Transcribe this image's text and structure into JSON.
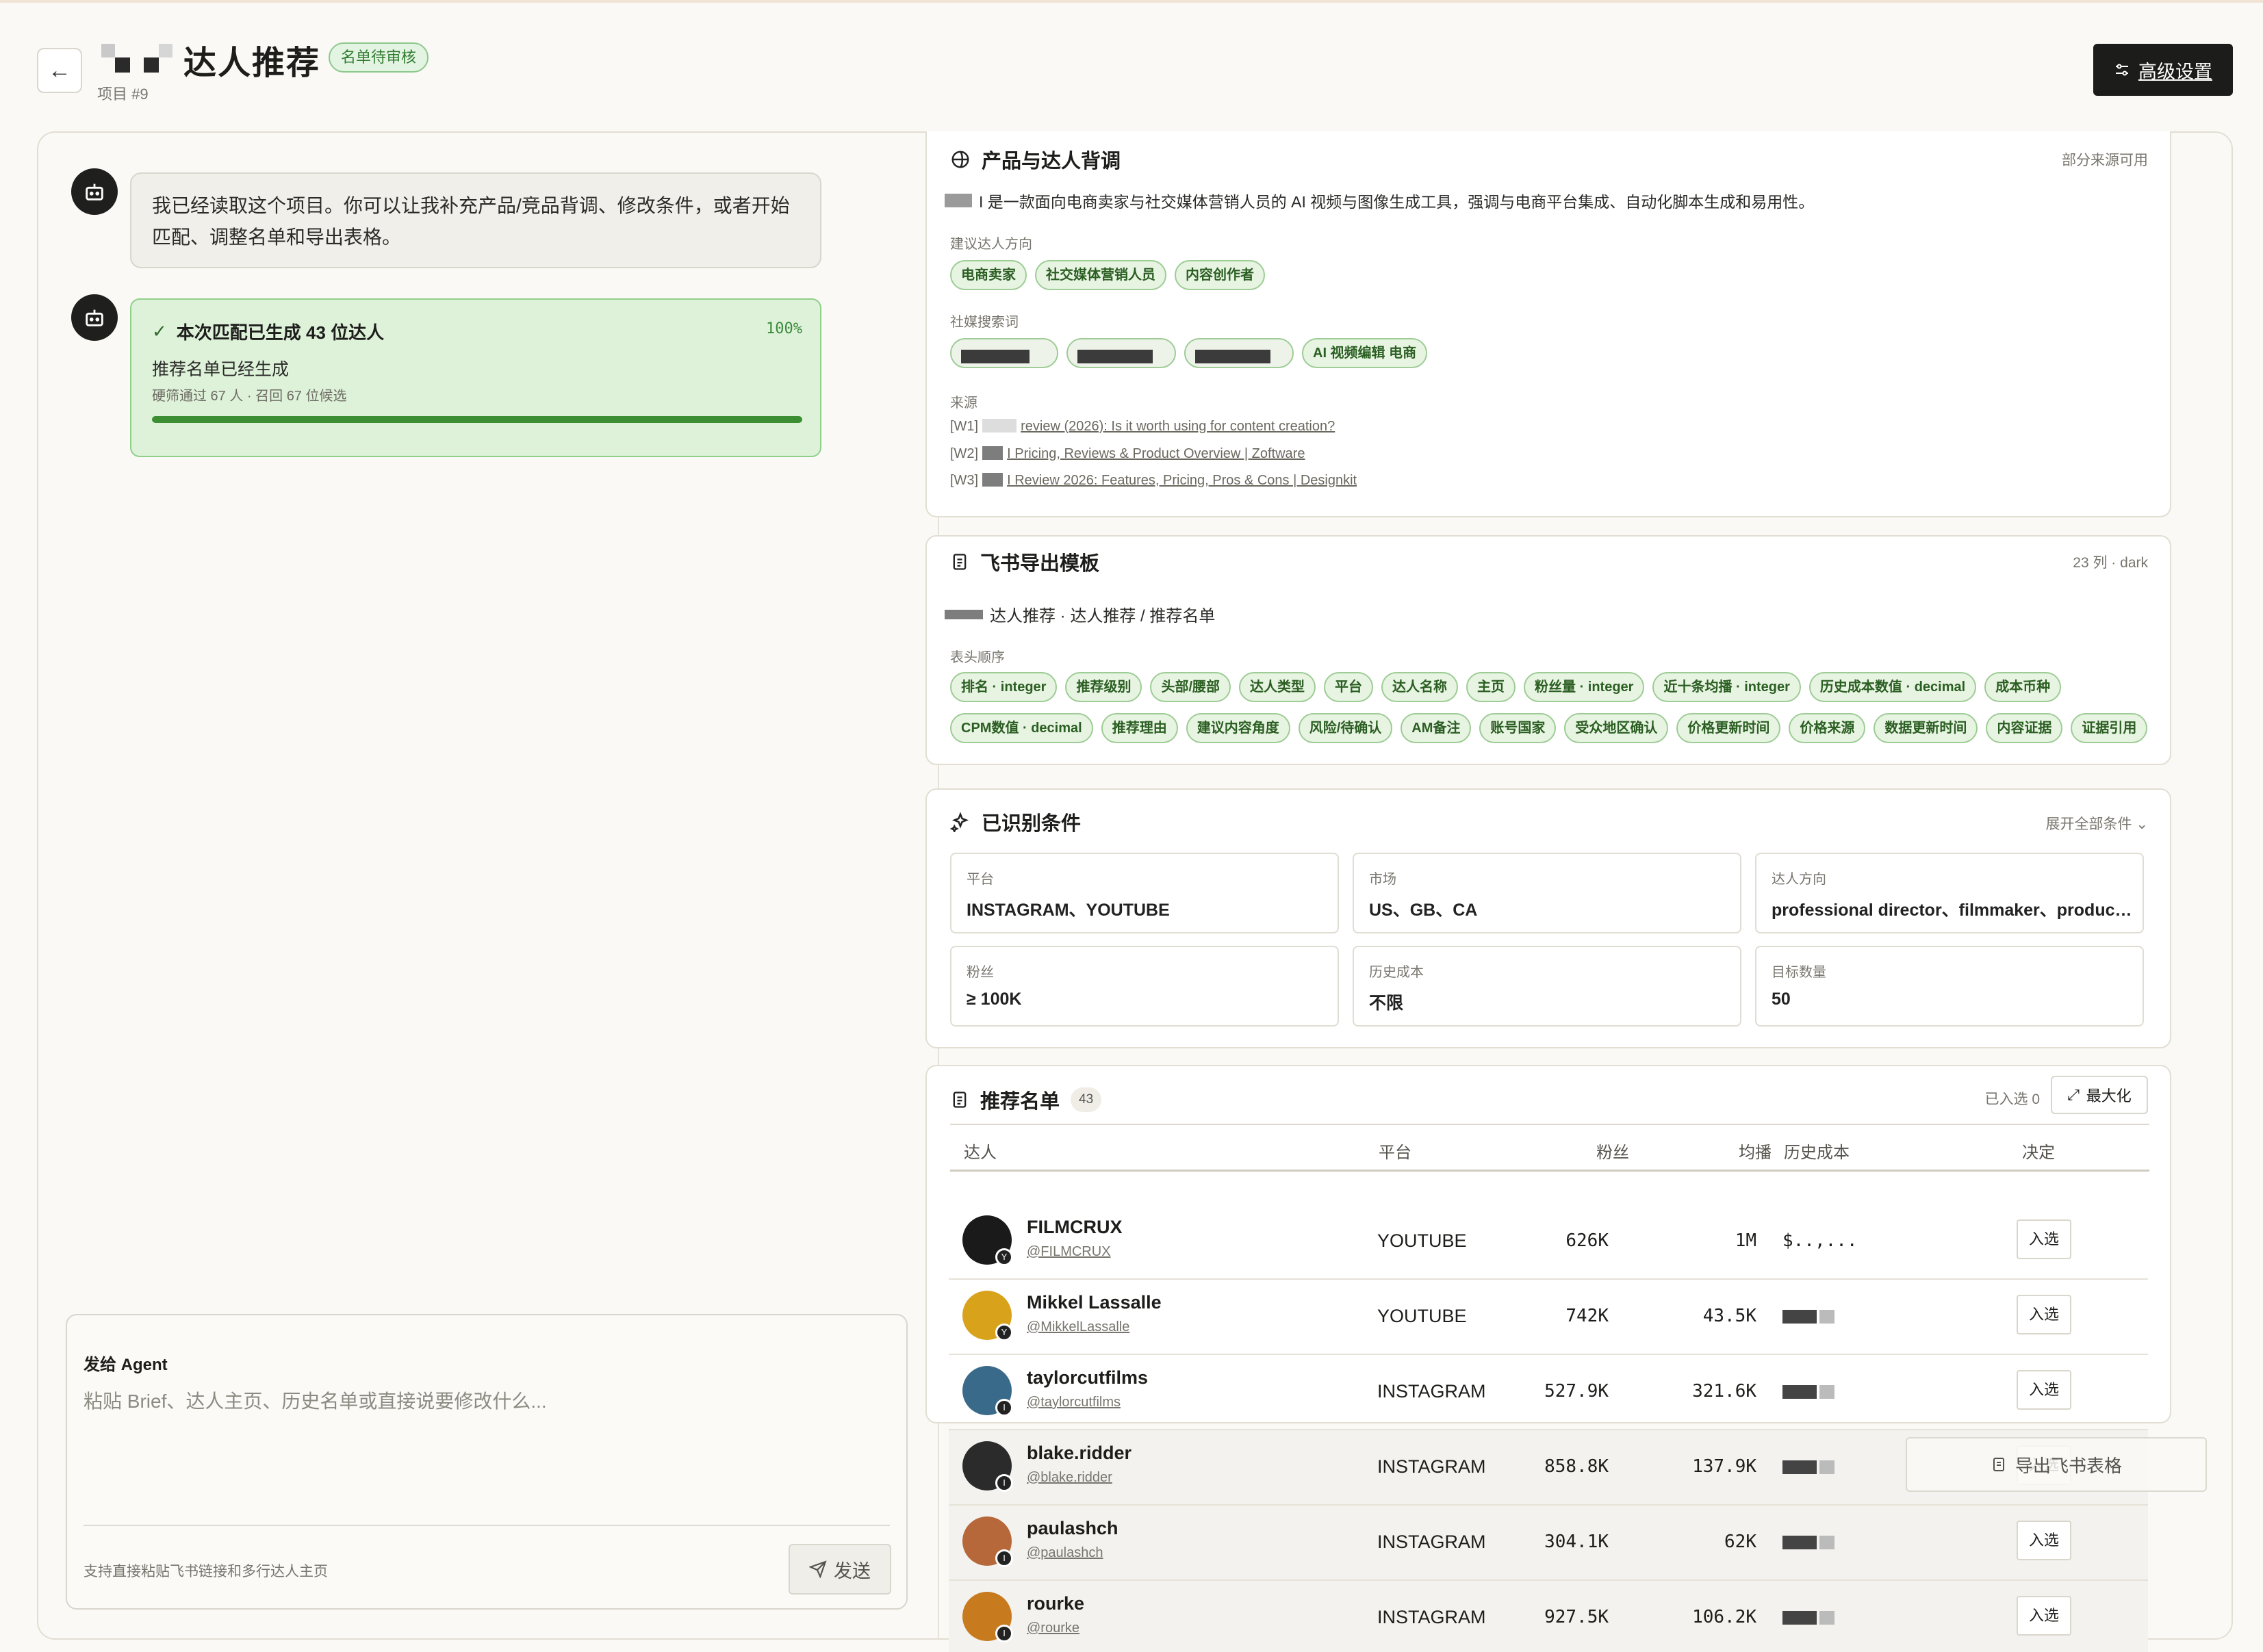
{
  "header": {
    "title": "达人推荐",
    "status": "名单待审核",
    "project": "项目 #9",
    "advanced_settings": "高级设置"
  },
  "chat": {
    "greeting": "我已经读取这个项目。你可以让我补充产品/竞品背调、修改条件，或者开始匹配、调整名单和导出表格。",
    "result": {
      "title": "本次匹配已生成 43 位达人",
      "percent": "100%",
      "progress": 1.0,
      "subtitle": "推荐名单已经生成",
      "meta": "硬筛通过 67 人 · 召回 67 位候选"
    },
    "composer": {
      "label": "发给 Agent",
      "placeholder": "粘贴 Brief、达人主页、历史名单或直接说要修改什么...",
      "hint": "支持直接粘贴飞书链接和多行达人主页",
      "send": "发送"
    }
  },
  "background": {
    "title": "产品与达人背调",
    "status": "部分来源可用",
    "description": "I 是一款面向电商卖家与社交媒体营销人员的 AI 视频与图像生成工具，强调与电商平台集成、自动化脚本生成和易用性。",
    "direction_label": "建议达人方向",
    "directions": [
      "电商卖家",
      "社交媒体营销人员",
      "内容创作者"
    ],
    "keywords_label": "社媒搜索词",
    "keyword_visible": "AI 视频编辑 电商",
    "sources_label": "来源",
    "sources": [
      {
        "id": "[W1]",
        "text": "review (2026): Is it worth using for content creation?"
      },
      {
        "id": "[W2]",
        "text": "I Pricing, Reviews & Product Overview | Zoftware"
      },
      {
        "id": "[W3]",
        "text": "I Review 2026: Features, Pricing, Pros & Cons | Designkit"
      }
    ]
  },
  "template": {
    "title": "飞书导出模板",
    "meta": "23 列 · dark",
    "path": "达人推荐 · 达人推荐 / 推荐名单",
    "columns_label": "表头顺序",
    "columns_row1": [
      "排名 · integer",
      "推荐级别",
      "头部/腰部",
      "达人类型",
      "平台",
      "达人名称",
      "主页",
      "粉丝量 · integer",
      "近十条均播 · integer",
      "历史成本数值 · decimal",
      "成本币种"
    ],
    "columns_row2": [
      "CPM数值 · decimal",
      "推荐理由",
      "建议内容角度",
      "风险/待确认",
      "AM备注",
      "账号国家",
      "受众地区确认",
      "价格更新时间",
      "价格来源",
      "数据更新时间",
      "内容证据",
      "证据引用"
    ]
  },
  "conditions": {
    "title": "已识别条件",
    "expand": "展开全部条件",
    "items": [
      {
        "label": "平台",
        "value": "INSTAGRAM、YOUTUBE"
      },
      {
        "label": "市场",
        "value": "US、GB、CA"
      },
      {
        "label": "达人方向",
        "value": "professional director、filmmaker、produce..."
      },
      {
        "label": "粉丝",
        "value": "≥ 100K"
      },
      {
        "label": "历史成本",
        "value": "不限"
      },
      {
        "label": "目标数量",
        "value": "50"
      }
    ]
  },
  "list": {
    "title": "推荐名单",
    "count": "43",
    "selected": "已入选 0",
    "maximize": "最大化",
    "headers": {
      "creator": "达人",
      "platform": "平台",
      "fans": "粉丝",
      "avg": "均播",
      "cost": "历史成本",
      "decision": "决定"
    },
    "pick_label": "入选",
    "rows": [
      {
        "name": "FILMCRUX",
        "handle": "@FILMCRUX",
        "platform": "YOUTUBE",
        "fans": "626K",
        "avg": "1M",
        "cost": "$..,...",
        "avatar": "#1a1a1a",
        "badge": "Y"
      },
      {
        "name": "Mikkel Lassalle",
        "handle": "@MikkelLassalle",
        "platform": "YOUTUBE",
        "fans": "742K",
        "avg": "43.5K",
        "cost": "",
        "avatar": "#d9a21b",
        "badge": "Y"
      },
      {
        "name": "taylorcutfilms",
        "handle": "@taylorcutfilms",
        "platform": "INSTAGRAM",
        "fans": "527.9K",
        "avg": "321.6K",
        "cost": "",
        "avatar": "#3a6a8a",
        "badge": "I"
      },
      {
        "name": "blake.ridder",
        "handle": "@blake.ridder",
        "platform": "INSTAGRAM",
        "fans": "858.8K",
        "avg": "137.9K",
        "cost": "",
        "avatar": "#2b2b2b",
        "badge": "I"
      },
      {
        "name": "paulashch",
        "handle": "@paulashch",
        "platform": "INSTAGRAM",
        "fans": "304.1K",
        "avg": "62K",
        "cost": "",
        "avatar": "#b7683a",
        "badge": "I"
      },
      {
        "name": "rourke",
        "handle": "@rourke",
        "platform": "INSTAGRAM",
        "fans": "927.5K",
        "avg": "106.2K",
        "cost": "",
        "avatar": "#c77a1e",
        "badge": "I"
      }
    ]
  },
  "export": {
    "label": "导出飞书表格"
  }
}
